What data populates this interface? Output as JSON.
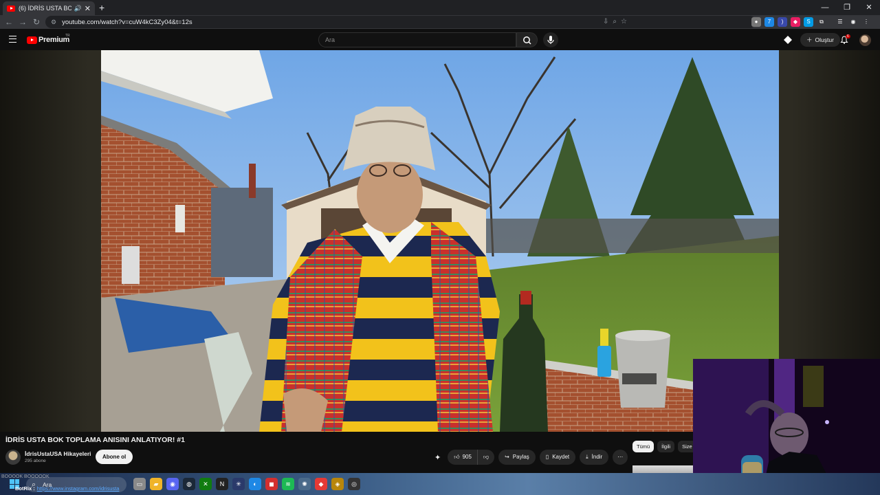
{
  "browser": {
    "tab_title": "(6) İDRİS USTA BOK TOPLAMA ANISINI ANLATIYOR! #1",
    "url": "youtube.com/watch?v=cuW4kC3Zy04&t=12s"
  },
  "youtube": {
    "brand": "Premium",
    "country": "TR",
    "search_placeholder": "Ara",
    "create_label": "Oluştur",
    "notif_count": "6"
  },
  "video": {
    "title": "İDRİS USTA BOK TOPLAMA ANISINI ANLATIYOR! #1",
    "channel_name": "İdrisUstaUSA Hikayeleri",
    "subscribers": "295 abone",
    "subscribe_label": "Abone ol",
    "likes": "905",
    "share_label": "Paylaş",
    "save_label": "Kaydet",
    "download_label": "İndir"
  },
  "chips": [
    "Tümü",
    "İlgili",
    "Size"
  ],
  "taskbar": {
    "search_label": "Ara",
    "overlay_text": "BOOOOK BOOOOOK",
    "botrix_name": "BotRix :",
    "botrix_link": "https://www.instagram.com/idrisusta"
  }
}
